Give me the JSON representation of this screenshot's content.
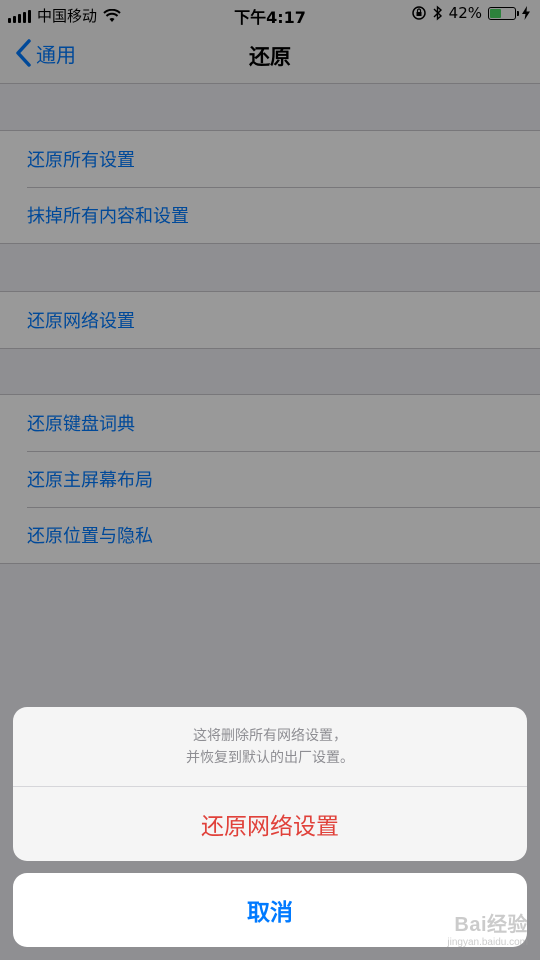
{
  "status_bar": {
    "carrier": "中国移动",
    "time": "下午4:17",
    "battery_percent_label": "42%",
    "battery_level": 0.42
  },
  "nav": {
    "back_label": "通用",
    "title": "还原"
  },
  "groups": [
    {
      "items": [
        "还原所有设置",
        "抹掉所有内容和设置"
      ]
    },
    {
      "items": [
        "还原网络设置"
      ]
    },
    {
      "items": [
        "还原键盘词典",
        "还原主屏幕布局",
        "还原位置与隐私"
      ]
    }
  ],
  "action_sheet": {
    "message_line1": "这将删除所有网络设置，",
    "message_line2": "并恢复到默认的出厂设置。",
    "destructive_label": "还原网络设置",
    "cancel_label": "取消"
  },
  "watermark": {
    "main": "Bai经验",
    "sub": "jingyan.baidu.com"
  },
  "colors": {
    "link_blue": "#007AFF",
    "destructive_red": "#E0413A",
    "battery_green": "#4CD964",
    "background": "#EFEFF4"
  },
  "icons": [
    "signal-bars-icon",
    "wifi-icon",
    "orientation-lock-icon",
    "bluetooth-icon",
    "battery-icon",
    "charging-bolt-icon",
    "chevron-left-icon"
  ]
}
